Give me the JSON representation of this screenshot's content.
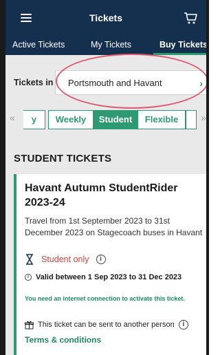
{
  "header": {
    "title": "Tickets"
  },
  "tabs": [
    {
      "label": "Active Tickets"
    },
    {
      "label": "My Tickets"
    },
    {
      "label": "Buy Tickets"
    }
  ],
  "tickets_in": {
    "label": "Tickets in",
    "selected": "Portsmouth and Havant"
  },
  "filters": {
    "chips": [
      "y",
      "Weekly",
      "Student",
      "Flexible"
    ],
    "active": "Student"
  },
  "section_title": "STUDENT TICKETS",
  "ticket": {
    "name": "Havant Autumn StudentRider 2023-24",
    "description": "Travel from 1st September 2023 to 31st December 2023 on Stagecoach buses in Havant",
    "student_only": "Student only",
    "validity": "Valid between 1 Sep 2023 to 31 Dec 2023",
    "connection_note": "You need an internet connection to activate this ticket.",
    "transfer_note": "This ticket can be sent to another person",
    "terms": "Terms & conditions"
  },
  "colors": {
    "header_bg": "#15304f",
    "accent_green": "#2e9a73",
    "annotation_red": "#e05a6e",
    "student_red": "#d4433c"
  }
}
